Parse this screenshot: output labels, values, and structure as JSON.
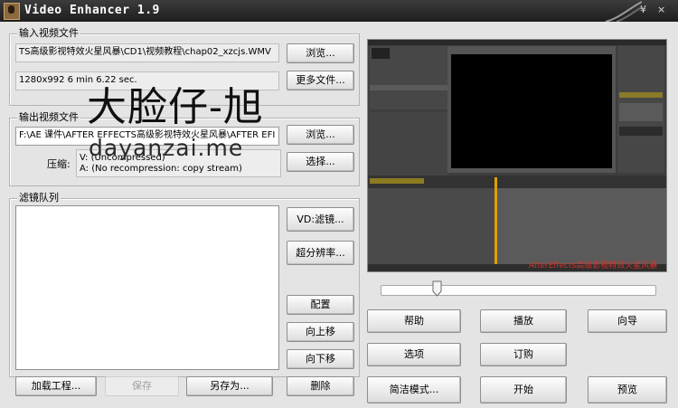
{
  "window": {
    "title": "Video Enhancer 1.9"
  },
  "input_group": {
    "label": "输入视频文件",
    "file": "TS高级影视特效火星风暴\\CD1\\视频教程\\chap02_xzcjs.WMV",
    "info": "1280x992 6 min 6.22 sec.",
    "browse_label": "浏览...",
    "more_files_label": "更多文件..."
  },
  "output_group": {
    "label": "输出视频文件",
    "file": "F:\\AE 课件\\AFTER EFFECTS高级影视特效火星风暴\\AFTER EFI",
    "browse_label": "浏览...",
    "compression_label": "压缩:",
    "video_codec": "V: (Uncompressed)",
    "audio_codec": "A: (No recompression: copy stream)",
    "select_label": "选择..."
  },
  "filter_group": {
    "label": "滤镜队列",
    "vd_filter_label": "VD:滤镜...",
    "super_res_label": "超分辨率...",
    "config_label": "配置",
    "move_up_label": "向上移",
    "move_down_label": "向下移",
    "delete_label": "删除"
  },
  "bottom_left": {
    "load_project_label": "加载工程...",
    "save_label": "保存",
    "save_as_label": "另存为..."
  },
  "actions": {
    "help": "帮助",
    "play": "播放",
    "wizard": "向导",
    "options": "选项",
    "order": "订购",
    "simple_mode": "简洁模式...",
    "start": "开始",
    "preview": "预览"
  },
  "preview": {
    "caption": "AfterEffects高级影视特效火星风暴",
    "slider_position": 0.2
  },
  "watermark": {
    "line1": "大脸仔-旭",
    "line2": "dayanzai.me"
  },
  "colors": {
    "title_bar": "#1e1e1e",
    "panel": "#e4e4e4",
    "preview_bg": "#3b3b3b",
    "preview_caption": "#d2352a"
  }
}
